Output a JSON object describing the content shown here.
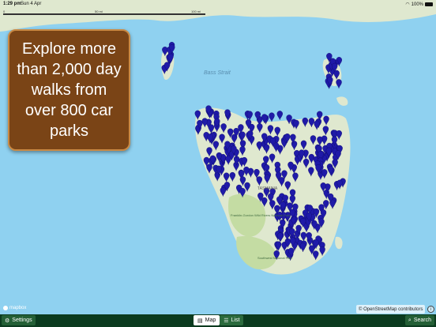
{
  "status_bar": {
    "time": "1:29 pm",
    "date": "Sun 4 Apr",
    "battery": "100%"
  },
  "map": {
    "scale_labels": [
      "0",
      "50 mi",
      "100 mi"
    ],
    "labels": {
      "strait": "Bass Strait",
      "region": "TASMANIA",
      "park1": "Franklin-Gordon Wild Rivers National Park",
      "park2": "Southwest National Park"
    },
    "colors": {
      "water": "#8fd1f0",
      "land": "#dfe8cf",
      "park": "#c4dca3",
      "pin": "#1f1aa8"
    },
    "attribution": "© OpenStreetMap contributors",
    "logo": "mapbox"
  },
  "promo": {
    "text": "Explore more than 2,000 day walks from over 800 car parks"
  },
  "toolbar": {
    "settings_label": "Settings",
    "map_label": "Map",
    "list_label": "List",
    "search_label": "Search"
  }
}
